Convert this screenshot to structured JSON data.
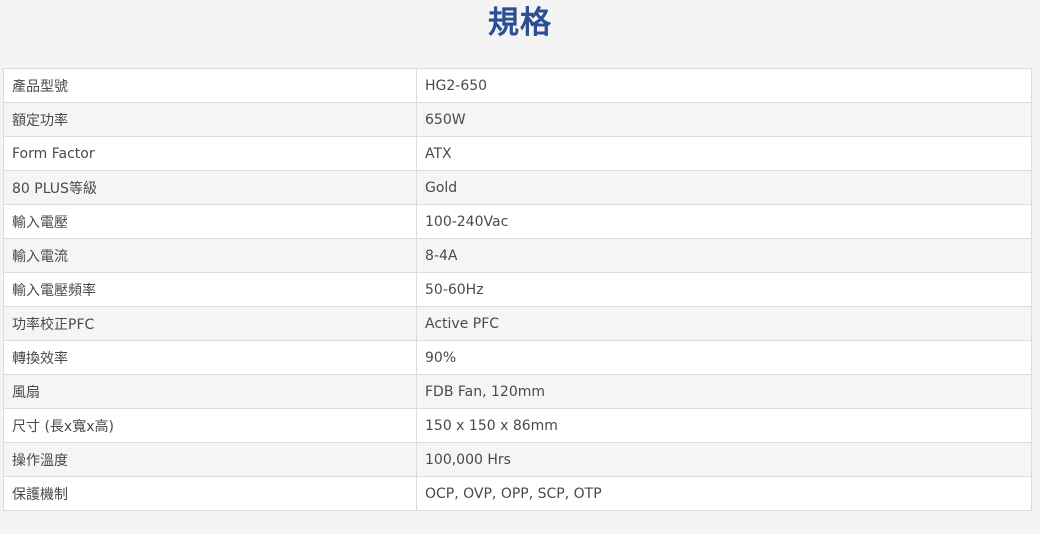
{
  "page": {
    "title": "規格"
  },
  "spec_table": {
    "rows": [
      {
        "label": "產品型號",
        "value": "HG2-650"
      },
      {
        "label": "額定功率",
        "value": "650W"
      },
      {
        "label": "Form Factor",
        "value": "ATX"
      },
      {
        "label": "80 PLUS等級",
        "value": "Gold"
      },
      {
        "label": "輸入電壓",
        "value": "100-240Vac"
      },
      {
        "label": "輸入電流",
        "value": "8-4A"
      },
      {
        "label": "輸入電壓頻率",
        "value": "50-60Hz"
      },
      {
        "label": "功率校正PFC",
        "value": "Active PFC"
      },
      {
        "label": "轉換效率",
        "value": "90%"
      },
      {
        "label": "風扇",
        "value": "FDB Fan, 120mm"
      },
      {
        "label": "尺寸 (長x寬x高)",
        "value": "150 x 150 x 86mm"
      },
      {
        "label": "操作溫度",
        "value": "100,000 Hrs"
      },
      {
        "label": "保護機制",
        "value": "OCP, OVP, OPP, SCP, OTP"
      }
    ]
  },
  "colors": {
    "title": "#2c4f93",
    "background": "#f4f4f4",
    "row_white": "#ffffff",
    "row_gray": "#f5f5f5",
    "border": "#dcdcdc",
    "text": "#4a4a4a"
  }
}
